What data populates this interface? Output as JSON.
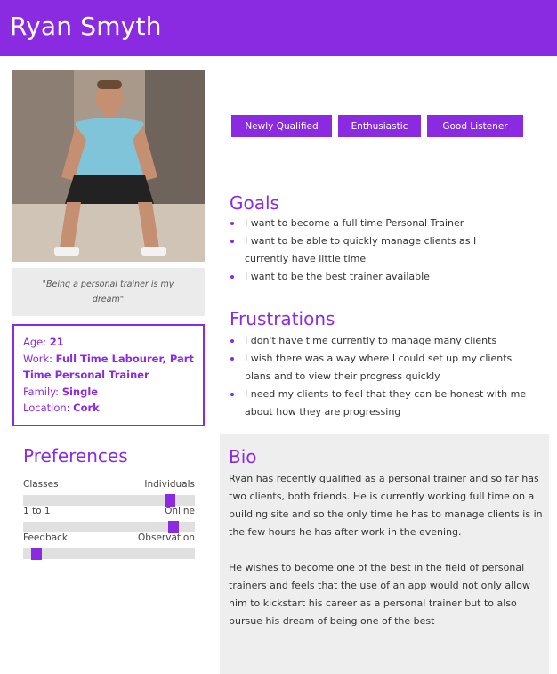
{
  "header": {
    "name": "Ryan Smyth"
  },
  "quote": "\"Being a personal trainer is my dream\"",
  "info": {
    "age_label": "Age:",
    "age_value": "21",
    "work_label": "Work:",
    "work_value": "Full Time Labourer, Part Time Personal Trainer",
    "family_label": "Family:",
    "family_value": "Single",
    "location_label": "Location:",
    "location_value": "Cork"
  },
  "preferences": {
    "title": "Preferences",
    "scales": [
      {
        "left": "Classes",
        "right": "Individuals",
        "level": 0.88
      },
      {
        "left": "1 to 1",
        "right": "Online",
        "level": 0.9
      },
      {
        "left": "Feedback",
        "right": "Observation",
        "level": 0.05
      }
    ]
  },
  "tags": [
    "Newly Qualified",
    "Enthusiastic",
    "Good Listener"
  ],
  "goals": {
    "title": "Goals",
    "items": [
      "I want to become a full time Personal Trainer",
      "I want to be able to quickly manage clients as I currently have little time",
      "I want to be the best trainer available"
    ]
  },
  "frustrations": {
    "title": "Frustrations",
    "items": [
      "I don't have time currently to manage many clients",
      "I wish there was a way where I could set up my clients plans and to view their progress quickly",
      "I need my clients to feel that they can be honest with me about how they are progressing"
    ]
  },
  "bio": {
    "title": "Bio",
    "paragraphs": [
      "Ryan has recently qualified as a personal trainer and so far has two clients, both friends. He is currently working full time on a building site and so the only time he has to manage clients is in the few hours he has after work in the evening.",
      "He wishes to become one of the best in the field of personal trainers and feels that the use of an app would not only allow him to kickstart his career as a personal trainer but to also pursue his dream of being one of the best"
    ]
  },
  "colors": {
    "accent": "#8a2be2",
    "panel": "#eeeeee"
  }
}
